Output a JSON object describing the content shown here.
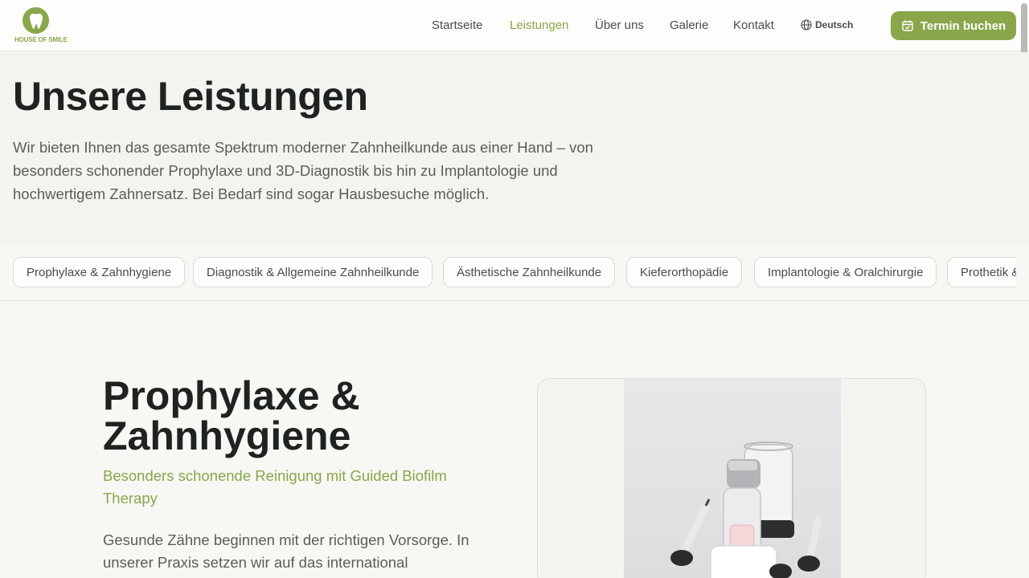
{
  "brand": {
    "name": "HOUSE OF SMILE",
    "color": "#8aa64a"
  },
  "nav": {
    "items": [
      {
        "label": "Startseite",
        "active": false
      },
      {
        "label": "Leistungen",
        "active": true
      },
      {
        "label": "Über uns",
        "active": false
      },
      {
        "label": "Galerie",
        "active": false
      },
      {
        "label": "Kontakt",
        "active": false
      }
    ],
    "language": "Deutsch",
    "cta": "Termin buchen"
  },
  "intro": {
    "title": "Unsere Leistungen",
    "lead": "Wir bieten Ihnen das gesamte Spektrum moderner Zahnheilkunde aus einer Hand – von besonders schonender Prophylaxe und 3D-Diagnostik bis hin zu Implantologie und hochwertigem Zahnersatz. Bei Bedarf sind sogar Hausbesuche möglich."
  },
  "tabs": [
    "Prophylaxe & Zahnhygiene",
    "Diagnostik & Allgemeine Zahnheilkunde",
    "Ästhetische Zahnheilkunde",
    "Kieferorthopädie",
    "Implantologie & Oralchirurgie",
    "Prothetik &"
  ],
  "section": {
    "title": "Prophylaxe & Zahnhygiene",
    "subtitle": "Besonders schonende Reinigung mit Guided Biofilm Therapy",
    "body": "Gesunde Zähne beginnen mit der richtigen Vorsorge. In unserer Praxis setzen wir auf das international"
  }
}
